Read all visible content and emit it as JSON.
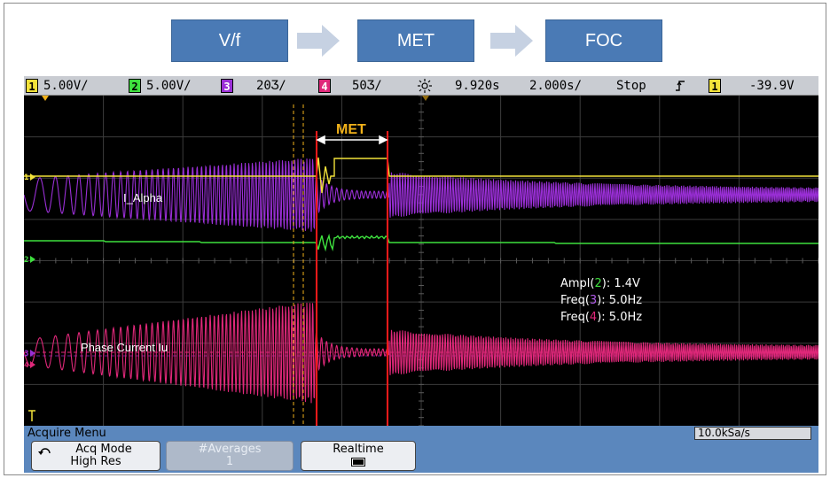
{
  "flow": {
    "steps": [
      "V/f",
      "MET",
      "FOC"
    ]
  },
  "status_bar": {
    "ch1_scale": "5.00V/",
    "ch2_scale": "5.00V/",
    "ch3_scale": "20Ʒ/",
    "ch4_scale": "50Ʒ/",
    "time_offset": "9.920s",
    "time_scale": "2.000s/",
    "run_state": "Stop",
    "trigger_level": "-39.9V"
  },
  "channel_markers": [
    "1",
    "2",
    "3",
    "4"
  ],
  "annotations": {
    "met_label": "MET",
    "i_alpha": "I_Alpha",
    "phase_current": "Phase Current Iu"
  },
  "measurements": {
    "ampl_prefix": "Ampl(",
    "ampl_ch": "2",
    "ampl_suffix": "): 1.4V",
    "freq3_prefix": "Freq(",
    "freq3_ch": "3",
    "freq3_suffix": "): 5.0Hz",
    "freq4_prefix": "Freq(",
    "freq4_ch": "4",
    "freq4_suffix": "): 5.0Hz"
  },
  "menu": {
    "title": "Acquire Menu",
    "sample_rate": "10.0kSa/s",
    "softkeys": {
      "acq_mode_label": "Acq Mode",
      "acq_mode_value": "High Res",
      "averages_label": "#Averages",
      "averages_value": "1",
      "realtime_label": "Realtime"
    }
  },
  "colors": {
    "ch1": "#f2e23a",
    "ch2": "#3ee03e",
    "ch3": "#9a2fd6",
    "ch4": "#e0287a",
    "met_marker": "#ff1a1a",
    "met_text": "#f2b21a",
    "flow_box": "#4a7ab5"
  }
}
